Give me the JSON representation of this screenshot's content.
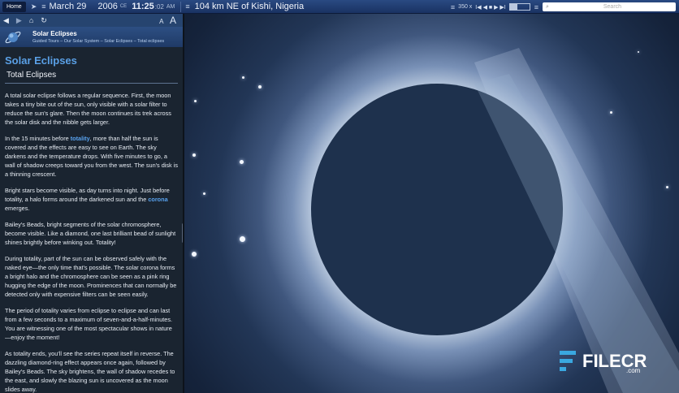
{
  "toolbar": {
    "home_label": "Home",
    "month_day": "March 29",
    "year": "2006",
    "era": "CE",
    "time": "11:25",
    "time_small": ":02",
    "ampm": "AM",
    "location": "104 km NE of Kishi, Nigeria",
    "rate": "350 x",
    "playback": "I◀ ◀ ■ ▶ ▶I",
    "search_placeholder": "Search"
  },
  "sidebar": {
    "text_size_small": "A",
    "text_size_large": "A",
    "header_title": "Solar Eclipses",
    "breadcrumb": "Guided Tours – Our Solar System – Solar Eclipses – Total eclipses"
  },
  "article": {
    "title": "Solar Eclipses",
    "subtitle": "Total Eclipses",
    "p1": "A total solar eclipse follows a regular sequence. First, the moon takes a tiny bite out of the sun, only visible with a solar filter to reduce the sun's glare. Then the moon continues its trek across the solar disk and the nibble gets larger.",
    "p2_pre": "In the 15 minutes before ",
    "p2_link": "totality",
    "p2_post": ", more than half the sun is covered and the effects are easy to see on Earth. The sky darkens and the temperature drops. With five minutes to go, a wall of shadow creeps toward you from the west. The sun's disk is a thinning crescent.",
    "p3_pre": "Bright stars become visible, as day turns into night. Just before totality, a halo forms around the darkened sun and the ",
    "p3_link": "corona",
    "p3_post": " emerges.",
    "p4": "Bailey's Beads, bright segments of the solar chromosphere, become visible. Like a diamond, one last brilliant bead of sunlight shines brightly before winking out. Totality!",
    "p5": "During totality, part of the sun can be observed safely with the naked eye—the only time that's possible. The solar corona forms a bright halo and the chromosphere can be seen as a pink ring hugging the edge of the moon. Prominences that can normally be detected only with expensive filters can be seen easily.",
    "p6": "The period of totality varies from eclipse to eclipse and can last from a few seconds to a maximum of seven-and-a-half-minutes. You are witnessing one of the most spectacular shows in nature—enjoy the moment!",
    "p7": "As totality ends, you'll see the series repeat itself in reverse. The dazzling diamond-ring effect appears once again, followed by Bailey's Beads. The sky brightens, the wall of shadow recedes to the east, and slowly the blazing sun is uncovered as the moon slides away."
  },
  "watermark": {
    "name": "FILECR",
    "domain": ".com"
  },
  "colors": {
    "toolbar": "#1f3a6c",
    "sidebar_bg": "#1a2430",
    "link": "#58a2ee",
    "title": "#5aa0e6",
    "moon": "#1e314d"
  }
}
